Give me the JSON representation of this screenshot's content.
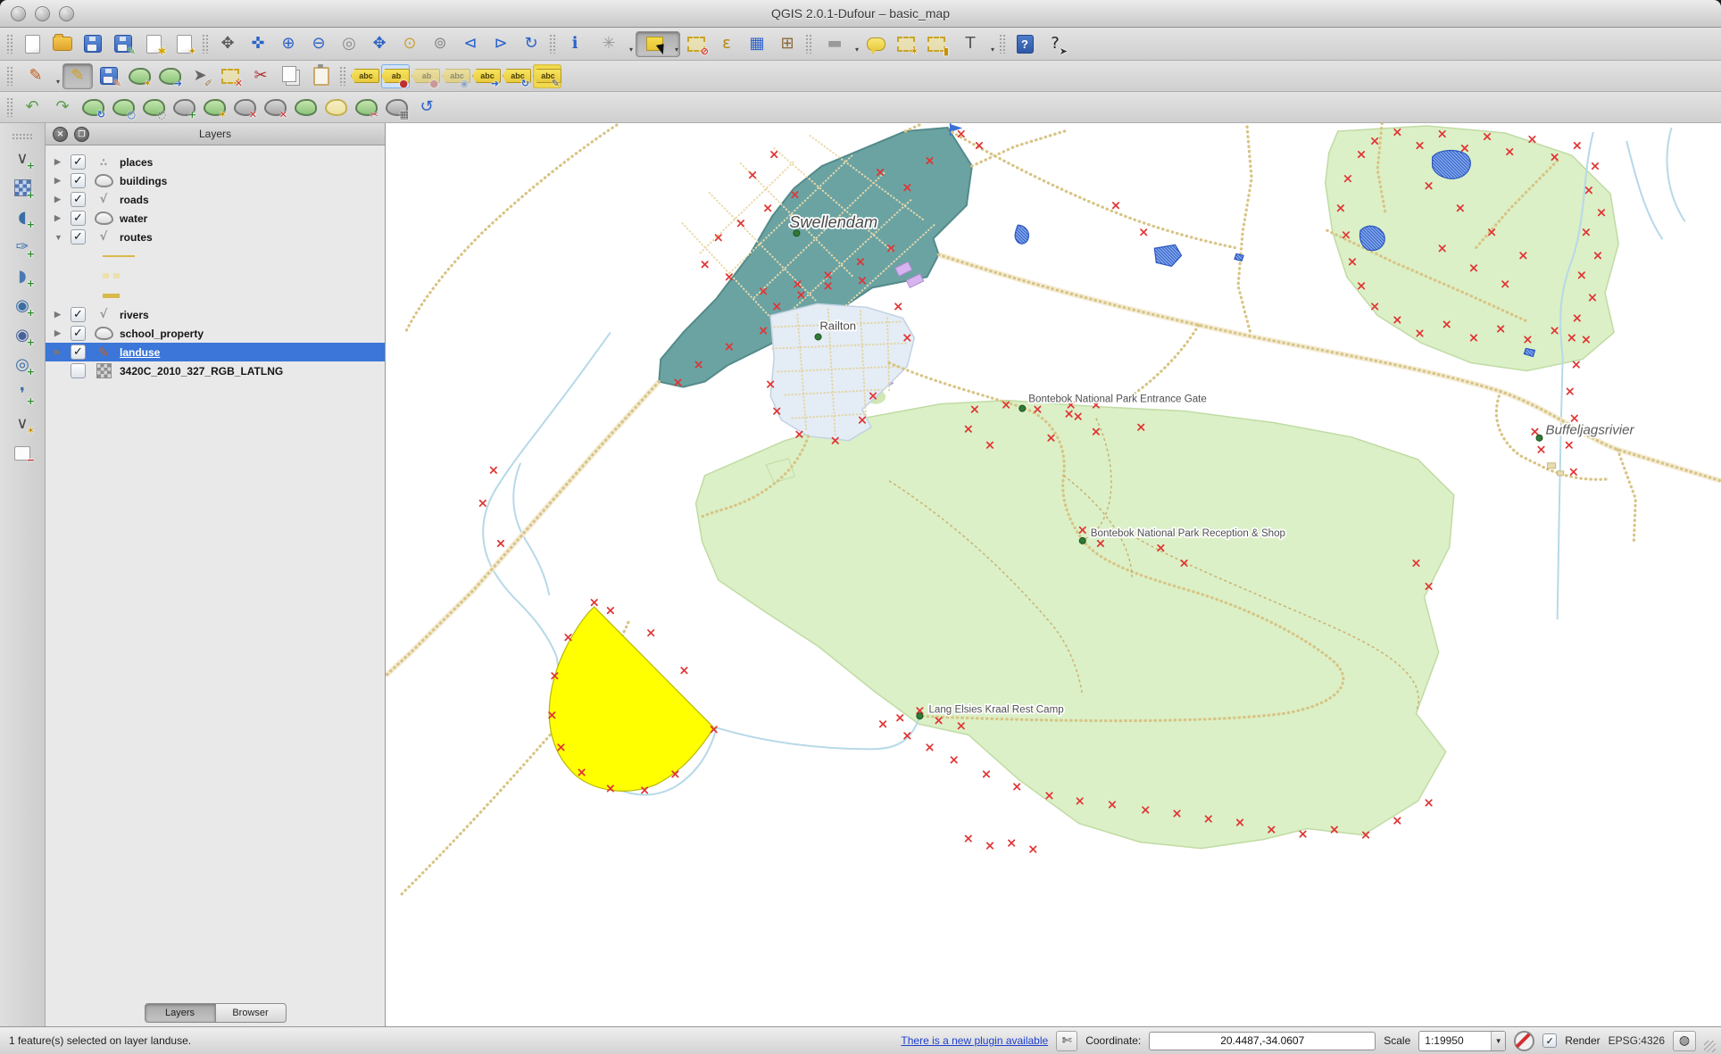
{
  "window": {
    "title": "QGIS 2.0.1-Dufour – basic_map"
  },
  "toolbars": {
    "row1": [
      {
        "n": "new-project",
        "s": "page",
        "sep": true
      },
      {
        "n": "open-project",
        "s": "folder"
      },
      {
        "n": "save-project",
        "s": "floppy"
      },
      {
        "n": "save-project-as",
        "s": "floppy",
        "b": "✎",
        "bc": "#2e8b2e"
      },
      {
        "n": "new-print-composer",
        "s": "page",
        "b": "✱",
        "bc": "#d4a500"
      },
      {
        "n": "composer-manager",
        "s": "page",
        "b": "✦",
        "bc": "#c79100"
      },
      {
        "n": "pan-map",
        "g": "✥",
        "c": "#5a5a5a",
        "sep": true
      },
      {
        "n": "pan-to-selection",
        "g": "✜",
        "c": "#2a62c9"
      },
      {
        "n": "zoom-in",
        "g": "⊕",
        "c": "#2a62c9"
      },
      {
        "n": "zoom-out",
        "g": "⊖",
        "c": "#2a62c9"
      },
      {
        "n": "zoom-native",
        "g": "◎",
        "c": "#8a8a8a"
      },
      {
        "n": "zoom-full",
        "g": "✥",
        "c": "#2a62c9"
      },
      {
        "n": "zoom-to-selection",
        "g": "⊙",
        "c": "#c9a23a"
      },
      {
        "n": "zoom-to-layer",
        "g": "⊚",
        "c": "#8a8a8a"
      },
      {
        "n": "zoom-last",
        "g": "⊲",
        "c": "#2a62c9"
      },
      {
        "n": "zoom-next",
        "g": "⊳",
        "c": "#2a62c9"
      },
      {
        "n": "refresh",
        "g": "↻",
        "c": "#2a62c9"
      },
      {
        "n": "identify-features",
        "g": "ℹ",
        "c": "#2a62c9",
        "sep": true
      },
      {
        "n": "run-feature-action",
        "g": "✳",
        "c": "#9a9a9a",
        "d": true
      },
      {
        "n": "select-features",
        "s": "selbox",
        "p": true,
        "d": true
      },
      {
        "n": "deselect-features",
        "s": "dashbox",
        "b": "⊘",
        "bc": "#d32f2f"
      },
      {
        "n": "select-by-expression",
        "g": "ε",
        "c": "#b8860b"
      },
      {
        "n": "attribute-table",
        "g": "▦",
        "c": "#2a62c9"
      },
      {
        "n": "field-calculator",
        "g": "⊞",
        "c": "#8a6a3a"
      },
      {
        "n": "measure",
        "g": "▬",
        "c": "#9a9a9a",
        "d": true,
        "sep": true
      },
      {
        "n": "map-tips",
        "s": "bubble"
      },
      {
        "n": "new-bookmark",
        "s": "dashbox",
        "b": "✶",
        "bc": "#c79100"
      },
      {
        "n": "show-bookmarks",
        "s": "dashbox",
        "b": "▮",
        "bc": "#c79100"
      },
      {
        "n": "text-annotation",
        "g": "T",
        "c": "#555555",
        "d": true
      },
      {
        "n": "help",
        "s": "helpbook",
        "t": "?",
        "sep": true
      },
      {
        "n": "whats-this",
        "g": "?",
        "c": "#222222",
        "b": "➤",
        "bc": "#333333"
      }
    ],
    "row2": [
      {
        "n": "current-edits",
        "g": "✎",
        "c": "#c05c1a",
        "d": true,
        "sep": true
      },
      {
        "n": "toggle-editing",
        "g": "✎",
        "c": "#d4a017",
        "p": true
      },
      {
        "n": "save-layer-edits",
        "s": "floppy",
        "b": "✎",
        "bc": "#c05c1a"
      },
      {
        "n": "add-feature",
        "s": "blob",
        "b": "✶",
        "bc": "#c79100"
      },
      {
        "n": "move-feature",
        "s": "blob",
        "b": "➜",
        "bc": "#2a62c9"
      },
      {
        "n": "node-tool",
        "g": "➤",
        "c": "#666666",
        "b": "✐",
        "bc": "#8a6a3a"
      },
      {
        "n": "delete-selected",
        "s": "dashbox",
        "b": "✕",
        "bc": "#d32f2f"
      },
      {
        "n": "cut-features",
        "g": "✂",
        "c": "#b03030"
      },
      {
        "n": "copy-features",
        "s": "pages"
      },
      {
        "n": "paste-features",
        "s": "clip"
      },
      {
        "n": "label-settings",
        "s": "tag",
        "t": "abc",
        "sep": true
      },
      {
        "n": "pin-labels",
        "s": "tag",
        "t": "ab",
        "b": "●",
        "bc": "#c03030",
        "hl": "blue"
      },
      {
        "n": "highlight-pinned-labels",
        "s": "tag",
        "t": "ab",
        "b": "●",
        "bc": "#c06060",
        "dim": true
      },
      {
        "n": "show-hide-labels",
        "s": "tag",
        "t": "abc",
        "b": "◉",
        "bc": "#4a7ab5",
        "dim": true
      },
      {
        "n": "move-label",
        "s": "tag",
        "t": "abc",
        "b": "➜",
        "bc": "#2a62c9"
      },
      {
        "n": "rotate-label",
        "s": "tag",
        "t": "abc",
        "b": "↻",
        "bc": "#2a62c9"
      },
      {
        "n": "change-label-properties",
        "s": "tag",
        "t": "abc",
        "b": "✎",
        "bc": "#444444",
        "hl": "yellow"
      }
    ],
    "row3": [
      {
        "n": "undo",
        "g": "↶",
        "c": "#5a9e4b",
        "sep": true
      },
      {
        "n": "redo",
        "g": "↷",
        "c": "#5a9e4b"
      },
      {
        "n": "rotate-feature",
        "s": "blob",
        "b": "↻",
        "bc": "#2a62c9"
      },
      {
        "n": "simplify-feature",
        "s": "blob",
        "b": "○",
        "bc": "#2a62c9"
      },
      {
        "n": "add-ring",
        "s": "blob",
        "b": "◌",
        "bc": "#555555"
      },
      {
        "n": "add-part",
        "s": "blob",
        "gray": true,
        "b": "+",
        "bc": "#2e8b2e"
      },
      {
        "n": "fill-ring",
        "s": "blob",
        "b": "✶",
        "bc": "#c79100"
      },
      {
        "n": "delete-ring",
        "s": "blob",
        "gray": true,
        "b": "✕",
        "bc": "#c03030"
      },
      {
        "n": "delete-part",
        "s": "blob",
        "gray": true,
        "b": "✕",
        "bc": "#d32f2f"
      },
      {
        "n": "reshape-features",
        "s": "blob"
      },
      {
        "n": "offset-curve",
        "s": "blob",
        "yellow": true
      },
      {
        "n": "split-features",
        "s": "blob",
        "b": "✂",
        "bc": "#b03030"
      },
      {
        "n": "merge-features",
        "s": "blob",
        "gray": true,
        "b": "▦",
        "bc": "#555555"
      },
      {
        "n": "rotate-point-symbols",
        "g": "↺",
        "c": "#2a62c9"
      }
    ],
    "left": [
      {
        "n": "add-vector-layer",
        "g": "∨",
        "c": "#4a4a4a",
        "b": "+",
        "bc": "#2e8b2e",
        "sep": true
      },
      {
        "n": "add-raster-layer",
        "s": "checker",
        "b": "+",
        "bc": "#2e8b2e"
      },
      {
        "n": "add-postgis-layer",
        "g": "◖",
        "c": "#3a6ea5",
        "b": "+",
        "bc": "#2e8b2e"
      },
      {
        "n": "add-spatialite-layer",
        "g": "✑",
        "c": "#4a7ab5",
        "b": "+",
        "bc": "#2e8b2e"
      },
      {
        "n": "add-mssql-layer",
        "g": "◗",
        "c": "#4a7ab5",
        "b": "+",
        "bc": "#2e8b2e"
      },
      {
        "n": "add-wms-layer",
        "g": "◉",
        "c": "#3a6ea5",
        "b": "+",
        "bc": "#2e8b2e"
      },
      {
        "n": "add-wcs-layer",
        "g": "◉",
        "c": "#46639c",
        "b": "+",
        "bc": "#2e8b2e"
      },
      {
        "n": "add-wfs-layer",
        "g": "◎",
        "c": "#3a6ea5",
        "b": "+",
        "bc": "#2e8b2e"
      },
      {
        "n": "add-oracle-layer",
        "g": "❜",
        "c": "#3a6ea5",
        "b": "+",
        "bc": "#2e8b2e"
      },
      {
        "n": "new-shapefile-layer",
        "g": "∨",
        "c": "#4a4a4a",
        "b": "✶",
        "bc": "#c79100"
      },
      {
        "n": "remove-layer",
        "s": "whitebox",
        "b": "−",
        "bc": "#d32f2f"
      }
    ]
  },
  "layers_panel": {
    "title": "Layers",
    "items": [
      {
        "label": "places",
        "checked": true,
        "symbol": "point",
        "expander": "right"
      },
      {
        "label": "buildings",
        "checked": true,
        "symbol": "polygon",
        "expander": "right"
      },
      {
        "label": "roads",
        "checked": true,
        "symbol": "line",
        "expander": "right"
      },
      {
        "label": "water",
        "checked": true,
        "symbol": "polygon",
        "expander": "right"
      },
      {
        "label": "routes",
        "checked": true,
        "symbol": "line",
        "expander": "down"
      },
      {
        "swatch": "line-solid"
      },
      {
        "swatch": "line-dashed"
      },
      {
        "swatch": "line-thick"
      },
      {
        "label": "rivers",
        "checked": true,
        "symbol": "line",
        "expander": "right"
      },
      {
        "label": "school_property",
        "checked": true,
        "symbol": "polygon",
        "expander": "right"
      },
      {
        "label": "landuse",
        "checked": true,
        "symbol": "pencil",
        "expander": "right",
        "selected": true
      },
      {
        "label": "3420C_2010_327_RGB_LATLNG",
        "checked": false,
        "symbol": "raster",
        "expander": ""
      }
    ],
    "tabs": {
      "layers": "Layers",
      "browser": "Browser"
    }
  },
  "map": {
    "labels": {
      "town": "Swellendam",
      "suburb": "Railton",
      "entrance": "Bontebok National Park Entrance Gate",
      "reception": "Bontebok National Park Reception & Shop",
      "restcamp": "Lang Elsies Kraal Rest Camp",
      "river": "Buffeljagsrivier"
    },
    "colors": {
      "selection": "#ffff00",
      "park": "#dbf0c6",
      "urban": "#6ba3a3",
      "marker": "#e03434",
      "road": "#d8c485",
      "river": "#b7d9e8",
      "poi": "#2f7a35"
    }
  },
  "status_bar": {
    "message": "1 feature(s) selected on layer landuse.",
    "plugin_link": "There is a new plugin available",
    "coordinate_label": "Coordinate:",
    "coordinate_value": "20.4487,-34.0607",
    "scale_label": "Scale",
    "scale_value": "1:19950",
    "render_label": "Render",
    "crs_label": "EPSG:4326"
  }
}
